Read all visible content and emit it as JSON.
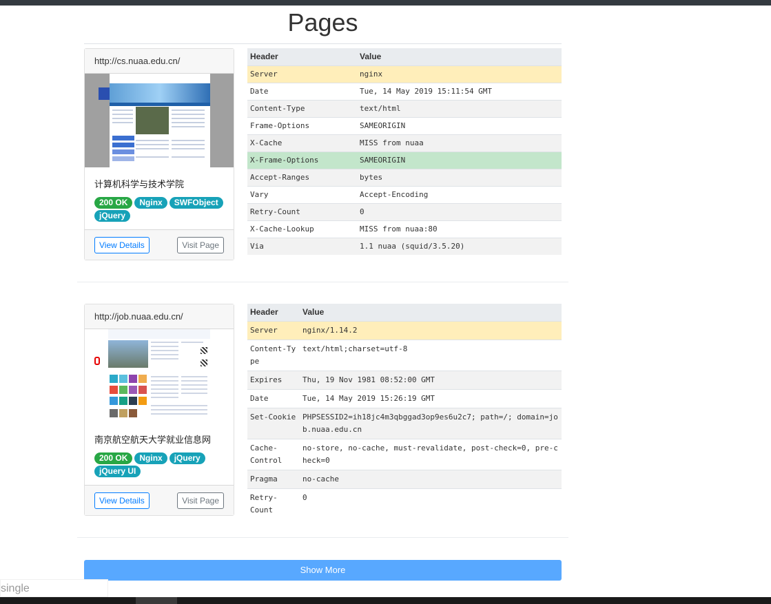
{
  "page": {
    "title": "Pages",
    "show_more": "Show More",
    "search_text": "single"
  },
  "colors": {
    "ok_badge": "#28a745",
    "tech_badge": "#17a2b8",
    "primary": "#007bff",
    "highlight_warn": "#ffeeba",
    "highlight_good": "#c3e6cb"
  },
  "pages": [
    {
      "url": "http://cs.nuaa.edu.cn/",
      "title": "计算机科学与技术学院",
      "status": "200 OK",
      "technologies": [
        "Nginx",
        "SWFObject",
        "jQuery"
      ],
      "view_details": "View Details",
      "visit_page": "Visit Page",
      "headers_table": {
        "col_header": "Header",
        "col_value": "Value",
        "rows": [
          {
            "name": "Server",
            "value": "nginx"
          },
          {
            "name": "Date",
            "value": "Tue, 14 May 2019 15:11:54 GMT"
          },
          {
            "name": "Content-Type",
            "value": "text/html"
          },
          {
            "name": "Frame-Options",
            "value": "SAMEORIGIN"
          },
          {
            "name": "X-Cache",
            "value": "MISS from nuaa"
          },
          {
            "name": "X-Frame-Options",
            "value": "SAMEORIGIN"
          },
          {
            "name": "Accept-Ranges",
            "value": "bytes"
          },
          {
            "name": "Vary",
            "value": "Accept-Encoding"
          },
          {
            "name": "Retry-Count",
            "value": "0"
          },
          {
            "name": "X-Cache-Lookup",
            "value": "MISS from nuaa:80"
          },
          {
            "name": "Via",
            "value": "1.1 nuaa (squid/3.5.20)"
          }
        ]
      }
    },
    {
      "url": "http://job.nuaa.edu.cn/",
      "title": "南京航空航天大学就业信息网",
      "status": "200 OK",
      "technologies": [
        "Nginx",
        "jQuery",
        "jQuery UI"
      ],
      "view_details": "View Details",
      "visit_page": "Visit Page",
      "headers_table": {
        "col_header": "Header",
        "col_value": "Value",
        "rows": [
          {
            "name": "Server",
            "value": "nginx/1.14.2"
          },
          {
            "name": "Content-Type",
            "value": "text/html;charset=utf-8"
          },
          {
            "name": "Expires",
            "value": "Thu, 19 Nov 1981 08:52:00 GMT"
          },
          {
            "name": "Date",
            "value": "Tue, 14 May 2019 15:26:19 GMT"
          },
          {
            "name": "Set-Cookie",
            "value": "PHPSESSID2=ih18jc4m3qbggad3op9es6u2c7; path=/; domain=job.nuaa.edu.cn"
          },
          {
            "name": "Cache-Control",
            "value": "no-store, no-cache, must-revalidate, post-check=0, pre-check=0"
          },
          {
            "name": "Pragma",
            "value": "no-cache"
          },
          {
            "name": "Retry-Count",
            "value": "0"
          }
        ]
      }
    }
  ]
}
